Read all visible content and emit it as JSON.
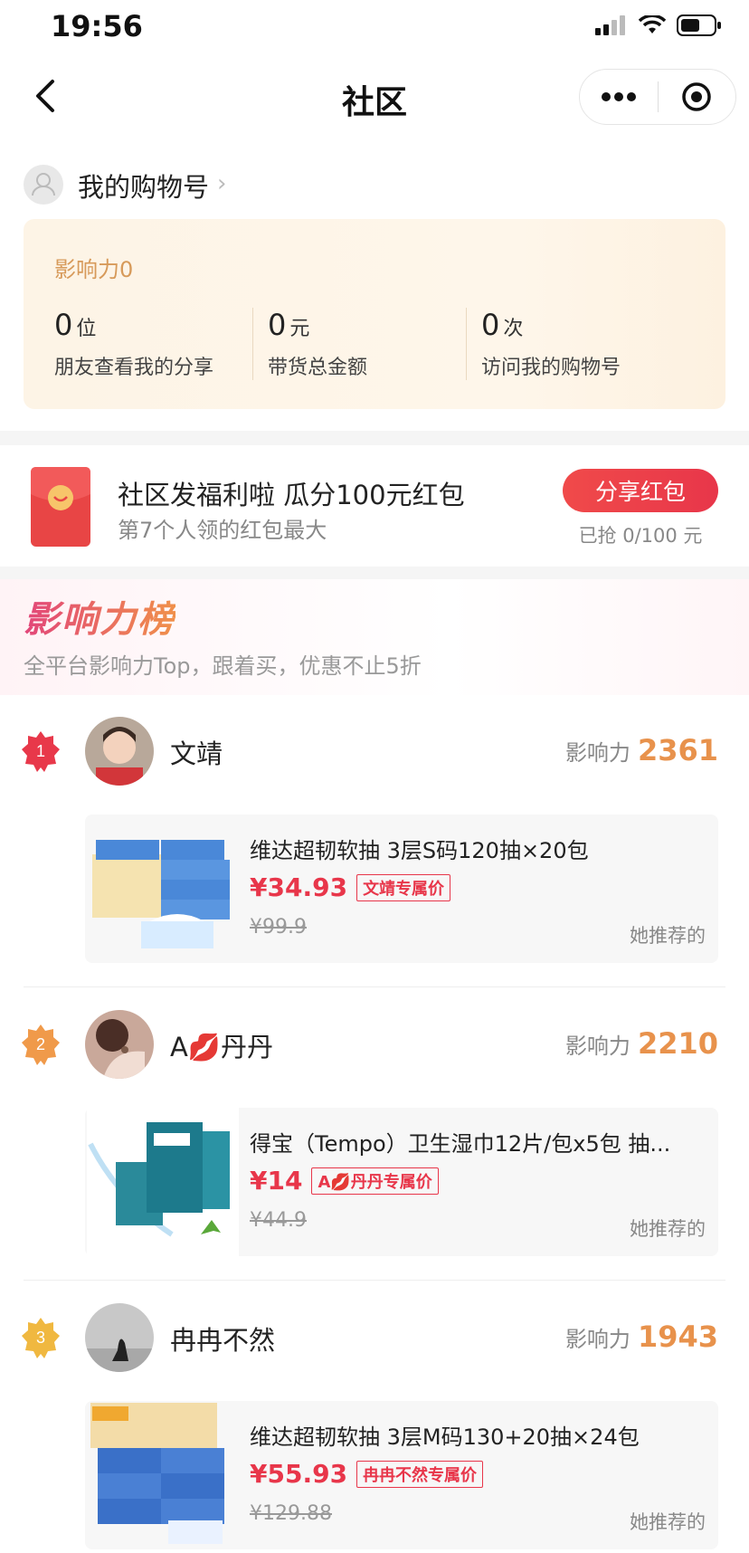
{
  "status": {
    "time": "19:56"
  },
  "nav": {
    "title": "社区"
  },
  "account": {
    "label": "我的购物号"
  },
  "stats": {
    "title": "影响力0",
    "items": [
      {
        "num": "0",
        "unit": "位",
        "label": "朋友查看我的分享"
      },
      {
        "num": "0",
        "unit": "元",
        "label": "带货总金额"
      },
      {
        "num": "0",
        "unit": "次",
        "label": "访问我的购物号"
      }
    ]
  },
  "packet": {
    "title": "社区发福利啦 瓜分100元红包",
    "sub": "第7个人领的红包最大",
    "button": "分享红包",
    "progress": "已抢 0/100 元"
  },
  "board": {
    "title": "影响力榜",
    "subtitle": "全平台影响力Top，跟着买，优惠不止5折",
    "influence_label": "影响力",
    "recommend_label": "她推荐的",
    "entries": [
      {
        "rank": "1",
        "name": "文靖",
        "score": "2361",
        "product": "维达超韧软抽 3层S码120抽×20包",
        "price": "¥34.93",
        "tag": "文靖专属价",
        "orig": "¥99.9"
      },
      {
        "rank": "2",
        "name": "A💋丹丹",
        "score": "2210",
        "product": "得宝（Tempo）卫生湿巾12片/包x5包 抽...",
        "price": "¥14",
        "tag": "A💋丹丹专属价",
        "orig": "¥44.9"
      },
      {
        "rank": "3",
        "name": "冉冉不然",
        "score": "1943",
        "product": "维达超韧软抽 3层M码130+20抽×24包",
        "price": "¥55.93",
        "tag": "冉冉不然专属价",
        "orig": "¥129.88"
      }
    ]
  },
  "colors": {
    "accent_red": "#e8364a",
    "influence_orange": "#e8924c",
    "badge_red": "#e8384a",
    "badge_orange": "#f09a4a",
    "badge_gold": "#f0b840"
  }
}
